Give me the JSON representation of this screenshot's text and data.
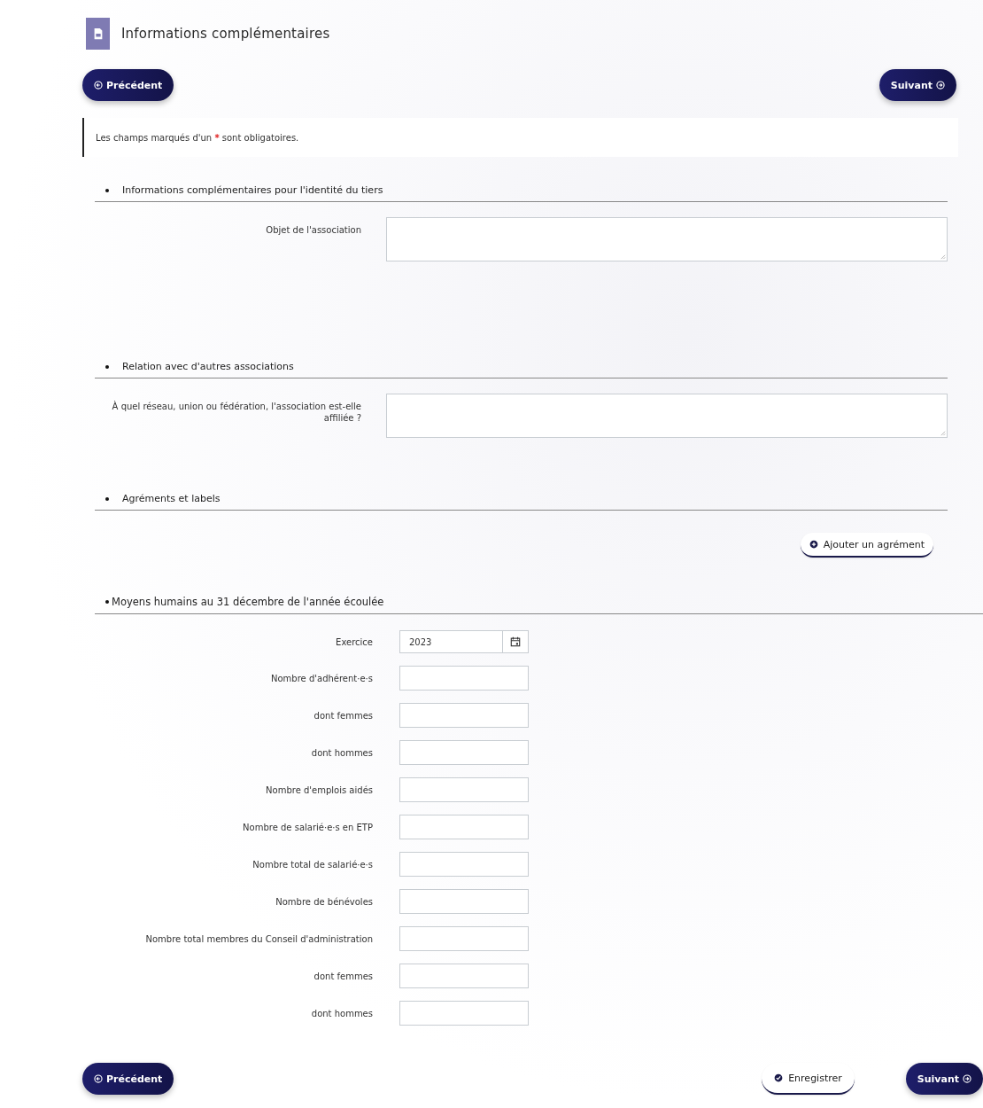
{
  "header": {
    "title": "Informations complémentaires"
  },
  "top_nav": {
    "previous": "Précédent",
    "next": "Suivant"
  },
  "notice": {
    "before": "Les champs marqués d'un",
    "mark": "*",
    "after": "sont obligatoires."
  },
  "sections": [
    {
      "title": "Informations complémentaires pour l'identité du tiers",
      "kind": "textareas",
      "fields": [
        {
          "label": "Objet de l'association"
        }
      ]
    },
    {
      "title": "Relation avec d'autres associations",
      "kind": "textareas",
      "fields": [
        {
          "label": "À quel réseau, union ou fédération, l'association est-elle affiliée ?"
        }
      ]
    },
    {
      "title": "Agréments et labels",
      "kind": "action",
      "action": "Ajouter un agrément"
    },
    {
      "title": "Moyens humains au 31 décembre de l'année écoulée",
      "kind": "inputs",
      "fields": [
        {
          "label": "Exercice",
          "kind": "date",
          "value": "2023"
        },
        {
          "label": "Nombre d'adhérent·e·s",
          "kind": "number"
        },
        {
          "label": "dont femmes",
          "kind": "number"
        },
        {
          "label": "dont hommes",
          "kind": "number"
        },
        {
          "label": "Nombre d'emplois aidés",
          "kind": "number"
        },
        {
          "label": "Nombre de salarié·e·s en ETP",
          "kind": "number"
        },
        {
          "label": "Nombre total de salarié·e·s",
          "kind": "number"
        },
        {
          "label": "Nombre de bénévoles",
          "kind": "number"
        },
        {
          "label": "Nombre total membres du Conseil d'administration",
          "kind": "number"
        },
        {
          "label": "dont femmes",
          "kind": "number"
        },
        {
          "label": "dont hommes",
          "kind": "number"
        }
      ]
    }
  ],
  "bottom_nav": {
    "previous": "Précédent",
    "save": "Enregistrer",
    "next": "Suivant"
  }
}
